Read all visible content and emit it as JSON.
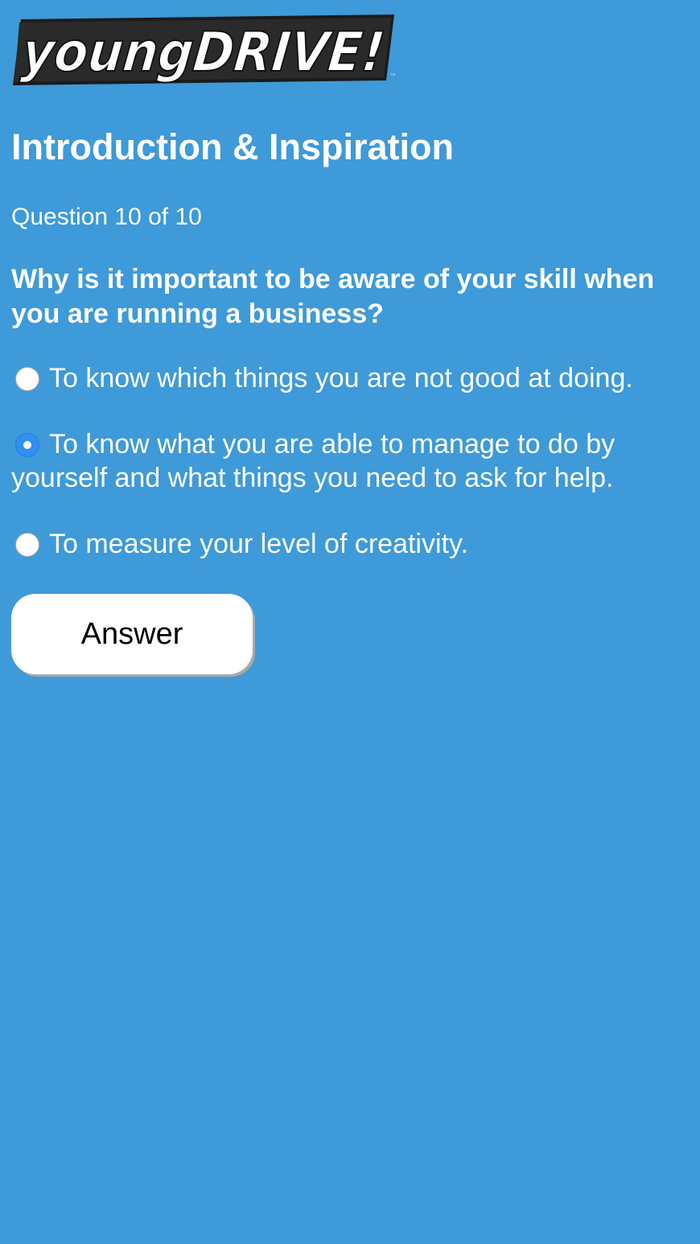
{
  "logo": {
    "text": "youngDRIVE!",
    "trademark": "™"
  },
  "colors": {
    "background": "#3e9ad8",
    "text": "#ffffff",
    "radio_selected": "#2f8ff2",
    "button_background": "#ffffff",
    "button_text": "#000000"
  },
  "page": {
    "title": "Introduction & Inspiration",
    "counter": "Question 10 of 10"
  },
  "quiz": {
    "question": "Why is it important to be aware of your skill when you are running a business?",
    "selected_index": 1,
    "options": [
      {
        "label": "To know which things you are not good at doing.",
        "selected": false
      },
      {
        "label": "To know what you are able to manage to do by yourself and what things you need to ask for help.",
        "selected": true
      },
      {
        "label": "To measure your level of creativity.",
        "selected": false
      }
    ],
    "answer_label": "Answer"
  }
}
